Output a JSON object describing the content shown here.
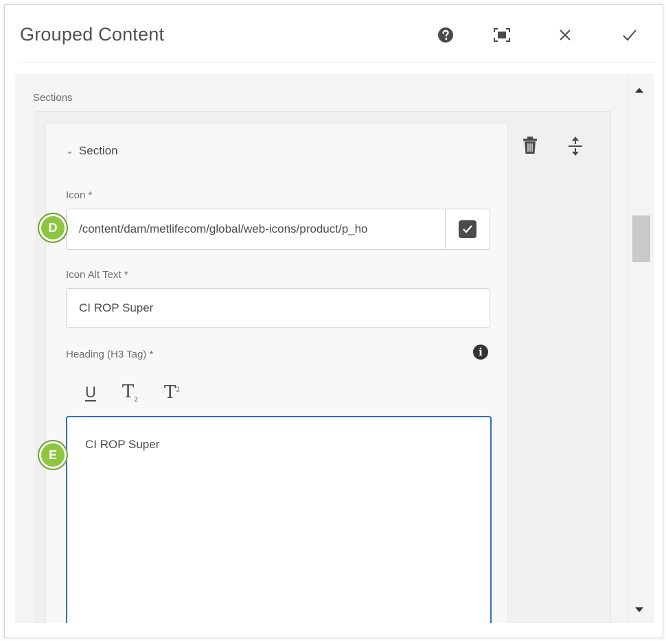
{
  "dialog": {
    "title": "Grouped Content",
    "buttons": {
      "help_icon": "help-icon",
      "fullscreen_icon": "fullscreen-icon",
      "close_icon": "close-icon",
      "done_icon": "check-icon"
    }
  },
  "sections": {
    "label": "Sections",
    "section": {
      "toggle_label": "Section",
      "delete_icon": "trash-icon",
      "reorder_icon": "reorder-icon",
      "icon_field": {
        "label": "Icon *",
        "value": "/content/dam/metlifecom/global/web-icons/product/p_ho",
        "browse_icon": "checkbox-icon"
      },
      "alt_text_field": {
        "label": "Icon Alt Text *",
        "value": "CI ROP Super"
      },
      "heading_field": {
        "label": "Heading (H3 Tag) *",
        "info_icon": "info-icon",
        "toolbar": [
          "U",
          "T",
          "T"
        ],
        "value": "CI ROP Super"
      }
    }
  },
  "markers": {
    "d": "D",
    "e": "E"
  },
  "colors": {
    "marker_fill": "#8dc63f",
    "focus_border": "#326ec8",
    "panel_bg": "#f4f4f4"
  }
}
